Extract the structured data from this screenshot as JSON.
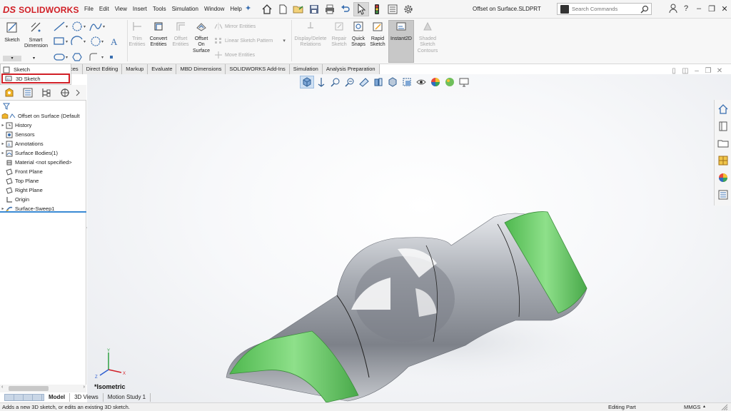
{
  "app": {
    "brand_mark": "DS",
    "brand": "SOLIDWORKS",
    "doc_title": "Offset on Surface.SLDPRT"
  },
  "menu": [
    "File",
    "Edit",
    "View",
    "Insert",
    "Tools",
    "Simulation",
    "Window",
    "Help"
  ],
  "search": {
    "placeholder": "Search Commands"
  },
  "window_controls": [
    "?",
    "–",
    "❐",
    "✕"
  ],
  "ribbon": {
    "sketch": "Sketch",
    "smart_dimension": [
      "Smart",
      "Dimension"
    ],
    "trim_entities": [
      "Trim",
      "Entities"
    ],
    "convert_entities": [
      "Convert",
      "Entities"
    ],
    "offset_entities": [
      "Offset",
      "Entities"
    ],
    "offset_on_surface": [
      "Offset",
      "On",
      "Surface"
    ],
    "mirror_entities": "Mirror Entities",
    "linear_sketch_pattern": "Linear Sketch Pattern",
    "move_entities": "Move Entities",
    "display_delete_relations": [
      "Display/Delete",
      "Relations"
    ],
    "repair_sketch": [
      "Repair",
      "Sketch"
    ],
    "quick_snaps": [
      "Quick",
      "Snaps"
    ],
    "rapid_sketch": [
      "Rapid",
      "Sketch"
    ],
    "instant2d": "Instant2D",
    "shaded_sketch_contours": [
      "Shaded",
      "Sketch",
      "Contours"
    ]
  },
  "tabs": [
    "ces",
    "Direct Editing",
    "Markup",
    "Evaluate",
    "MBD Dimensions",
    "SOLIDWORKS Add-Ins",
    "Simulation",
    "Analysis Preparation"
  ],
  "sketch_dropdown": {
    "items": [
      "Sketch",
      "3D Sketch"
    ],
    "highlighted": "3D Sketch"
  },
  "tree": {
    "root": "Offset on Surface  (Default",
    "items": [
      {
        "label": "History",
        "expandable": true,
        "icon": "history-icon"
      },
      {
        "label": "Sensors",
        "expandable": false,
        "icon": "sensors-icon"
      },
      {
        "label": "Annotations",
        "expandable": true,
        "icon": "annotations-icon"
      },
      {
        "label": "Surface Bodies(1)",
        "expandable": true,
        "icon": "surface-bodies-icon"
      },
      {
        "label": "Material <not specified>",
        "expandable": false,
        "icon": "material-icon"
      },
      {
        "label": "Front Plane",
        "expandable": false,
        "icon": "plane-icon"
      },
      {
        "label": "Top Plane",
        "expandable": false,
        "icon": "plane-icon"
      },
      {
        "label": "Right Plane",
        "expandable": false,
        "icon": "plane-icon"
      },
      {
        "label": "Origin",
        "expandable": false,
        "icon": "origin-icon"
      },
      {
        "label": "Surface-Sweep1",
        "expandable": true,
        "icon": "surface-sweep-icon"
      }
    ]
  },
  "bottom_tabs": [
    "Model",
    "3D Views",
    "Motion Study 1"
  ],
  "viewport": {
    "view_label": "*Isometric",
    "triad": {
      "x": "X",
      "y": "Y",
      "z": "Z"
    }
  },
  "status": {
    "message": "Adds a new 3D sketch, or edits an existing 3D sketch.",
    "mode": "Editing Part",
    "units": "MMGS"
  },
  "colors": {
    "brand_red": "#d11f26",
    "accent_blue": "#3a8ad4",
    "surface_green": "#5cc45c",
    "body_gray": "#8f939a"
  }
}
